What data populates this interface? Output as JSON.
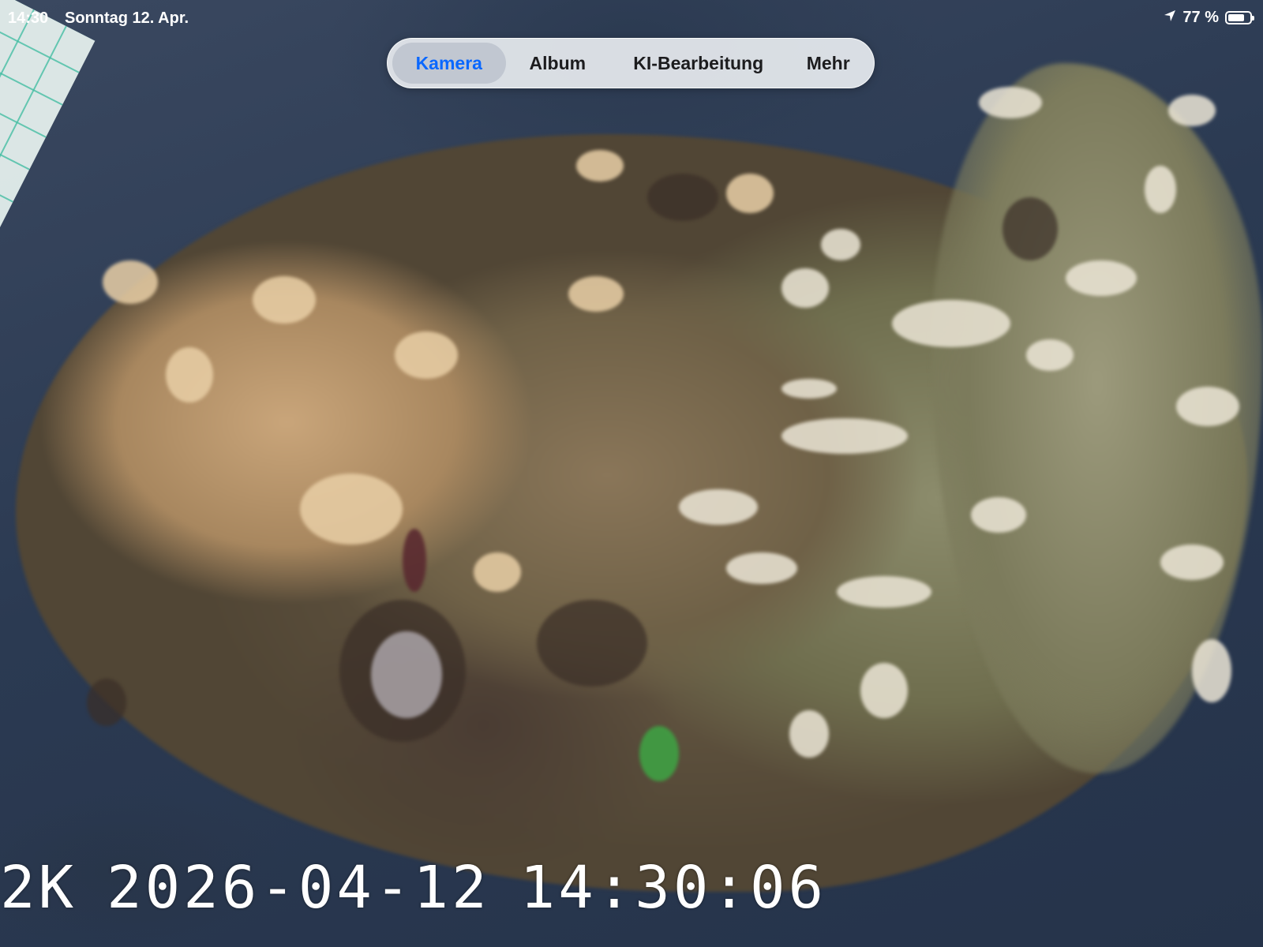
{
  "status_bar": {
    "time": "14:30",
    "date": "Sonntag 12. Apr.",
    "location_icon": "location-arrow-icon",
    "battery_percent_label": "77 %",
    "battery_level": 0.77,
    "battery_icon": "battery-icon"
  },
  "nav": {
    "tabs": [
      {
        "label": "Kamera",
        "active": true
      },
      {
        "label": "Album",
        "active": false
      },
      {
        "label": "KI-Bearbeitung",
        "active": false
      },
      {
        "label": "Mehr",
        "active": false
      }
    ],
    "active_color": "#0a68ff"
  },
  "overlay": {
    "resolution": "2K",
    "date": "2026-04-12",
    "time": "14:30:06"
  }
}
